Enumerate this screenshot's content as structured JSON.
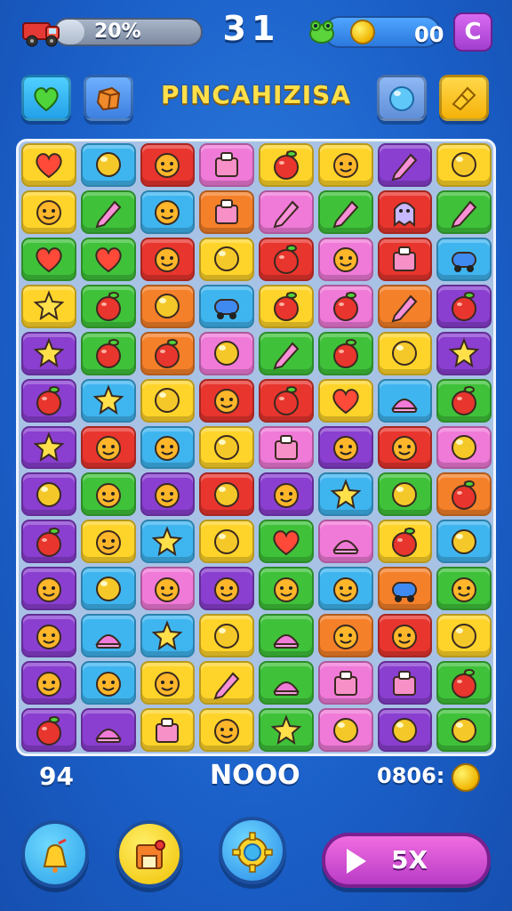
{
  "hud": {
    "progress_label": "20%",
    "progress_value": 0.2,
    "moves_counter": "31",
    "coins": "00",
    "menu_label": "C"
  },
  "title": "PINCAHIZISA",
  "board": {
    "rows": [
      [
        [
          "yellow",
          "heart"
        ],
        [
          "blue",
          "circle"
        ],
        [
          "red",
          "smile"
        ],
        [
          "pink",
          "box"
        ],
        [
          "yellow",
          "apple"
        ],
        [
          "yellow",
          "smile"
        ],
        [
          "purple",
          "pencil"
        ],
        [
          "yellow",
          "circle"
        ]
      ],
      [
        [
          "yellow",
          "smile"
        ],
        [
          "green",
          "pencil"
        ],
        [
          "blue",
          "smile"
        ],
        [
          "orange",
          "box"
        ],
        [
          "pink",
          "pencil"
        ],
        [
          "green",
          "pencil"
        ],
        [
          "red",
          "ghost"
        ],
        [
          "green",
          "pencil"
        ]
      ],
      [
        [
          "green",
          "heart"
        ],
        [
          "green",
          "heart"
        ],
        [
          "red",
          "smile"
        ],
        [
          "yellow",
          "circle"
        ],
        [
          "red",
          "apple"
        ],
        [
          "pink",
          "smile"
        ],
        [
          "red",
          "box"
        ],
        [
          "blue",
          "car"
        ]
      ],
      [
        [
          "yellow",
          "star"
        ],
        [
          "green",
          "apple"
        ],
        [
          "orange",
          "circle"
        ],
        [
          "blue",
          "car"
        ],
        [
          "yellow",
          "apple"
        ],
        [
          "pink",
          "apple"
        ],
        [
          "orange",
          "pencil"
        ],
        [
          "purple",
          "apple"
        ]
      ],
      [
        [
          "purple",
          "star"
        ],
        [
          "green",
          "apple"
        ],
        [
          "orange",
          "apple"
        ],
        [
          "pink",
          "circle"
        ],
        [
          "green",
          "pencil"
        ],
        [
          "green",
          "apple"
        ],
        [
          "yellow",
          "circle"
        ],
        [
          "purple",
          "star"
        ]
      ],
      [
        [
          "purple",
          "apple"
        ],
        [
          "blue",
          "star"
        ],
        [
          "yellow",
          "circle"
        ],
        [
          "red",
          "smile"
        ],
        [
          "red",
          "apple"
        ],
        [
          "yellow",
          "heart"
        ],
        [
          "blue",
          "cake"
        ],
        [
          "green",
          "apple"
        ]
      ],
      [
        [
          "purple",
          "star"
        ],
        [
          "red",
          "smile"
        ],
        [
          "blue",
          "smile"
        ],
        [
          "yellow",
          "circle"
        ],
        [
          "pink",
          "box"
        ],
        [
          "purple",
          "smile"
        ],
        [
          "red",
          "smile"
        ],
        [
          "pink",
          "circle"
        ]
      ],
      [
        [
          "purple",
          "circle"
        ],
        [
          "green",
          "smile"
        ],
        [
          "purple",
          "smile"
        ],
        [
          "red",
          "circle"
        ],
        [
          "purple",
          "smile"
        ],
        [
          "blue",
          "star"
        ],
        [
          "green",
          "circle"
        ],
        [
          "orange",
          "apple"
        ]
      ],
      [
        [
          "purple",
          "apple"
        ],
        [
          "yellow",
          "smile"
        ],
        [
          "blue",
          "star"
        ],
        [
          "yellow",
          "circle"
        ],
        [
          "green",
          "heart"
        ],
        [
          "pink",
          "cake"
        ],
        [
          "yellow",
          "apple"
        ],
        [
          "blue",
          "circle"
        ]
      ],
      [
        [
          "purple",
          "smile"
        ],
        [
          "blue",
          "circle"
        ],
        [
          "pink",
          "smile"
        ],
        [
          "purple",
          "smile"
        ],
        [
          "green",
          "smile"
        ],
        [
          "blue",
          "smile"
        ],
        [
          "orange",
          "car"
        ],
        [
          "green",
          "smile"
        ]
      ],
      [
        [
          "purple",
          "smile"
        ],
        [
          "blue",
          "cake"
        ],
        [
          "blue",
          "star"
        ],
        [
          "yellow",
          "circle"
        ],
        [
          "green",
          "cake"
        ],
        [
          "orange",
          "smile"
        ],
        [
          "red",
          "smile"
        ],
        [
          "yellow",
          "circle"
        ]
      ],
      [
        [
          "purple",
          "smile"
        ],
        [
          "blue",
          "smile"
        ],
        [
          "yellow",
          "smile"
        ],
        [
          "yellow",
          "pencil"
        ],
        [
          "green",
          "cake"
        ],
        [
          "pink",
          "box"
        ],
        [
          "purple",
          "box"
        ],
        [
          "green",
          "apple"
        ]
      ],
      [
        [
          "purple",
          "apple"
        ],
        [
          "purple",
          "cake"
        ],
        [
          "yellow",
          "box"
        ],
        [
          "yellow",
          "smile"
        ],
        [
          "green",
          "star"
        ],
        [
          "pink",
          "circle"
        ],
        [
          "purple",
          "circle"
        ],
        [
          "green",
          "circle"
        ]
      ]
    ]
  },
  "footer": {
    "left_value": "94",
    "center_value": "NOOO",
    "right_value": "0806:",
    "play_label": "5X"
  },
  "colors": {
    "yellow": "#ffd42a",
    "blue": "#3fb5f0",
    "red": "#e8352e",
    "pink": "#f07ad8",
    "green": "#3fc23a",
    "orange": "#f5802a",
    "purple": "#8a3fd0"
  },
  "icons": {
    "truck": "truck-icon",
    "coin": "coin-icon",
    "frog": "frog-icon",
    "heart_btn": "heart-icon",
    "crate_btn": "crate-icon",
    "bubble_btn": "bubble-icon",
    "ticket_btn": "ticket-icon",
    "bell_btn": "bell-icon",
    "shop_btn": "shop-icon",
    "gear_btn": "gear-icon",
    "play": "play-icon"
  }
}
